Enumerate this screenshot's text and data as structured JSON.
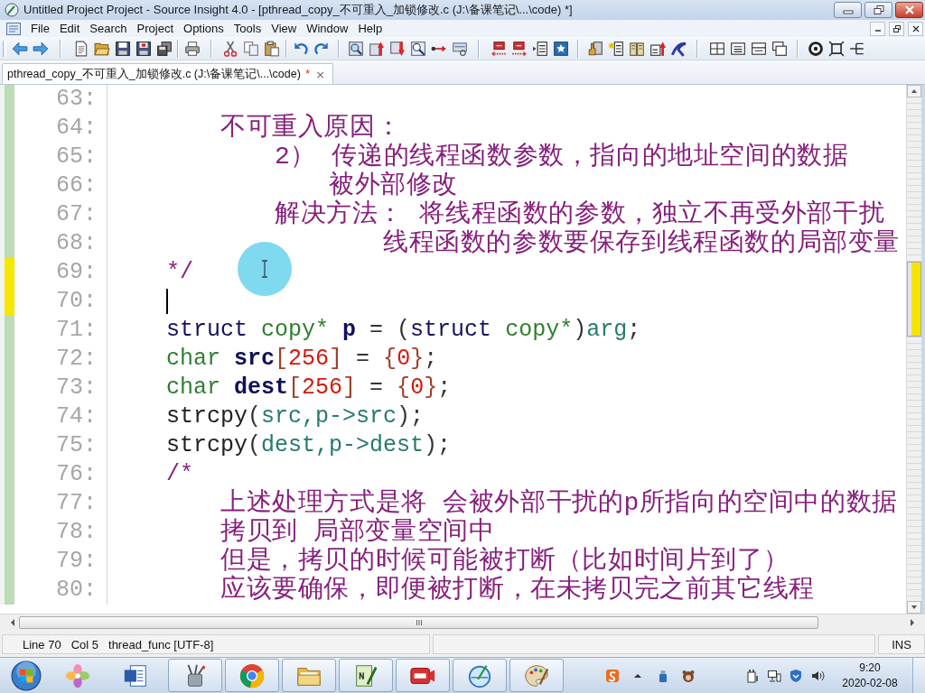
{
  "window": {
    "title": "Untitled Project Project - Source Insight 4.0 - [pthread_copy_不可重入_加锁修改.c (J:\\备课笔记\\...\\code) *]"
  },
  "menu_bar": {
    "items": [
      "File",
      "Edit",
      "Search",
      "Project",
      "Options",
      "Tools",
      "View",
      "Window",
      "Help"
    ]
  },
  "tabs": [
    {
      "label": "pthread_copy_不可重入_加锁修改.c (J:\\备课笔记\\...\\code)",
      "unsaved_mark": "*",
      "close": "×",
      "selected": true
    }
  ],
  "editor": {
    "lines": [
      {
        "number": "63:",
        "modified": false,
        "caret": false
      },
      {
        "number": "64:",
        "modified": false,
        "caret": false,
        "tokens": [
          {
            "kind": "comment",
            "text": "        不可重入原因："
          }
        ]
      },
      {
        "number": "65:",
        "modified": false,
        "caret": false,
        "tokens": [
          {
            "kind": "comment",
            "text": "            2） 传递的线程函数参数，指向的地址空间的数据"
          }
        ]
      },
      {
        "number": "66:",
        "modified": false,
        "caret": false,
        "tokens": [
          {
            "kind": "comment",
            "text": "                被外部修改"
          }
        ]
      },
      {
        "number": "67:",
        "modified": false,
        "caret": false,
        "tokens": [
          {
            "kind": "comment",
            "text": "            解决方法： 将线程函数的参数，独立不再受外部干扰"
          }
        ]
      },
      {
        "number": "68:",
        "modified": false,
        "caret": false,
        "tokens": [
          {
            "kind": "comment",
            "text": "                    线程函数的参数要保存到线程函数的局部变量"
          }
        ]
      },
      {
        "number": "69:",
        "modified": true,
        "caret": false,
        "tokens": [
          {
            "kind": "comment",
            "text": "    */"
          }
        ]
      },
      {
        "number": "70:",
        "modified": true,
        "caret": true
      },
      {
        "number": "71:",
        "modified": false,
        "caret": false,
        "tokens": [
          {
            "kind": "keyword",
            "text": "    struct "
          },
          {
            "kind": "type",
            "text": "copy* "
          },
          {
            "kind": "variable",
            "text": "p "
          },
          {
            "kind": "operator",
            "text": "= ("
          },
          {
            "kind": "keyword",
            "text": "struct "
          },
          {
            "kind": "type",
            "text": "copy*"
          },
          {
            "kind": "operator",
            "text": ")"
          },
          {
            "kind": "param",
            "text": "arg"
          },
          {
            "kind": "operator",
            "text": ";"
          }
        ]
      },
      {
        "number": "72:",
        "modified": false,
        "caret": false,
        "tokens": [
          {
            "kind": "type",
            "text": "    char "
          },
          {
            "kind": "variable",
            "text": "src"
          },
          {
            "kind": "bracket",
            "text": "["
          },
          {
            "kind": "number",
            "text": "256"
          },
          {
            "kind": "bracket",
            "text": "]"
          },
          {
            "kind": "operator",
            "text": " = "
          },
          {
            "kind": "bracket",
            "text": "{"
          },
          {
            "kind": "number",
            "text": "0"
          },
          {
            "kind": "bracket",
            "text": "}"
          },
          {
            "kind": "operator",
            "text": ";"
          }
        ]
      },
      {
        "number": "73:",
        "modified": false,
        "caret": false,
        "tokens": [
          {
            "kind": "type",
            "text": "    char "
          },
          {
            "kind": "variable",
            "text": "dest"
          },
          {
            "kind": "bracket",
            "text": "["
          },
          {
            "kind": "number",
            "text": "256"
          },
          {
            "kind": "bracket",
            "text": "]"
          },
          {
            "kind": "operator",
            "text": " = "
          },
          {
            "kind": "bracket",
            "text": "{"
          },
          {
            "kind": "number",
            "text": "0"
          },
          {
            "kind": "bracket",
            "text": "}"
          },
          {
            "kind": "operator",
            "text": ";"
          }
        ]
      },
      {
        "number": "74:",
        "modified": false,
        "caret": false,
        "tokens": [
          {
            "kind": "function",
            "text": "    strcpy"
          },
          {
            "kind": "operator",
            "text": "("
          },
          {
            "kind": "param",
            "text": "src,p->src"
          },
          {
            "kind": "operator",
            "text": ");"
          }
        ]
      },
      {
        "number": "75:",
        "modified": false,
        "caret": false,
        "tokens": [
          {
            "kind": "function",
            "text": "    strcpy"
          },
          {
            "kind": "operator",
            "text": "("
          },
          {
            "kind": "param",
            "text": "dest,p->dest"
          },
          {
            "kind": "operator",
            "text": ");"
          }
        ]
      },
      {
        "number": "76:",
        "modified": false,
        "caret": false,
        "tokens": [
          {
            "kind": "comment",
            "text": "    /*"
          }
        ]
      },
      {
        "number": "77:",
        "modified": false,
        "caret": false,
        "tokens": [
          {
            "kind": "comment",
            "text": "        上述处理方式是将 会被外部干扰的p所指向的空间中的数据"
          }
        ]
      },
      {
        "number": "78:",
        "modified": false,
        "caret": false,
        "tokens": [
          {
            "kind": "comment",
            "text": "        拷贝到 局部变量空间中"
          }
        ]
      },
      {
        "number": "79:",
        "modified": false,
        "caret": false,
        "tokens": [
          {
            "kind": "comment",
            "text": "        但是，拷贝的时候可能被打断（比如时间片到了）"
          }
        ]
      },
      {
        "number": "80:",
        "modified": false,
        "caret": false,
        "tokens": [
          {
            "kind": "comment",
            "text": "        应该要确保，即便被打断，在未拷贝完之前其它线程"
          }
        ]
      }
    ]
  },
  "status_bar": {
    "position": [
      "Line 70",
      "Col 5"
    ],
    "context": "thread_func [UTF-8]",
    "mode": "INS"
  },
  "taskbar": {
    "clock": {
      "time": "9:20",
      "date": "2020-02-08"
    }
  }
}
